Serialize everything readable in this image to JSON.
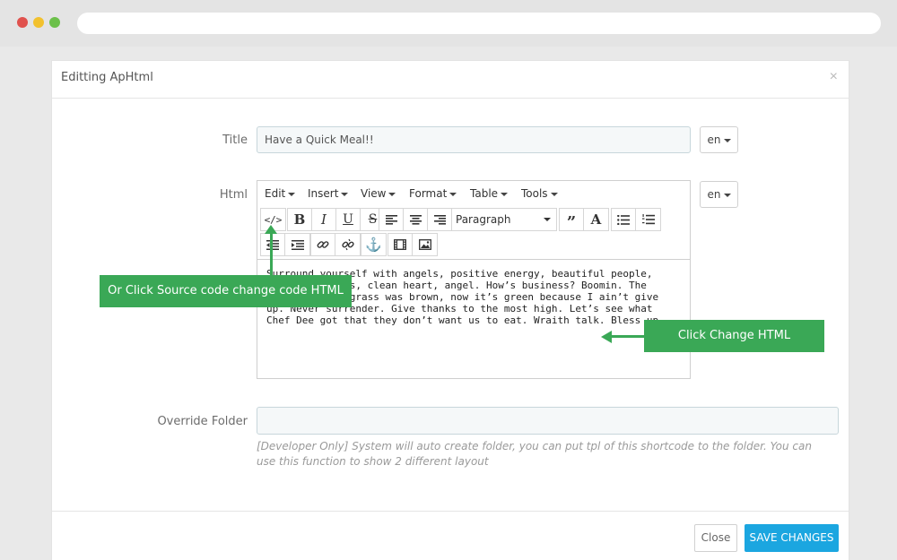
{
  "modal": {
    "title": "Editting ApHtml",
    "close_glyph": "×"
  },
  "form": {
    "title_label": "Title",
    "title_value": "Have a Quick Meal!!",
    "lang": "en",
    "html_label": "Html",
    "override_label": "Override Folder",
    "override_value": "",
    "help_text": "[Developer Only] System will auto create folder, you can put tpl of this shortcode to the folder. You can use this function to show 2 different layout"
  },
  "editor": {
    "menus": [
      "Edit",
      "Insert",
      "View",
      "Format",
      "Table",
      "Tools"
    ],
    "format_select": "Paragraph",
    "content": "Surround yourself with angels, positive energy, beautiful people, beautiful souls, clean heart, angel. How’s business? Boomin. The other day the grass was brown, now it’s green because I ain’t give up. Never surrender. Give thanks to the most high. Let’s see what Chef Dee got that they don’t want us to eat. Wraith talk. Bless up.",
    "icons": {
      "source_code": "code-icon",
      "bold": "bold-icon",
      "italic": "italic-icon",
      "underline": "underline-icon",
      "strike": "strikethrough-icon",
      "align_left": "align-left-icon",
      "align_center": "align-center-icon",
      "align_right": "align-right-icon",
      "blockquote": "blockquote-icon",
      "text_color": "text-color-icon",
      "bullet_list": "bullet-list-icon",
      "numbered_list": "numbered-list-icon",
      "outdent": "outdent-icon",
      "indent": "indent-icon",
      "link": "link-icon",
      "unlink": "unlink-icon",
      "anchor": "anchor-icon",
      "media": "media-icon",
      "image": "image-icon"
    }
  },
  "callouts": {
    "source": "Or Click Source code change code HTML",
    "change": "Click Change HTML"
  },
  "footer": {
    "close_label": "Close",
    "save_label": "SAVE CHANGES"
  },
  "colors": {
    "callout": "#3aa856",
    "primary": "#1ba6e0"
  }
}
